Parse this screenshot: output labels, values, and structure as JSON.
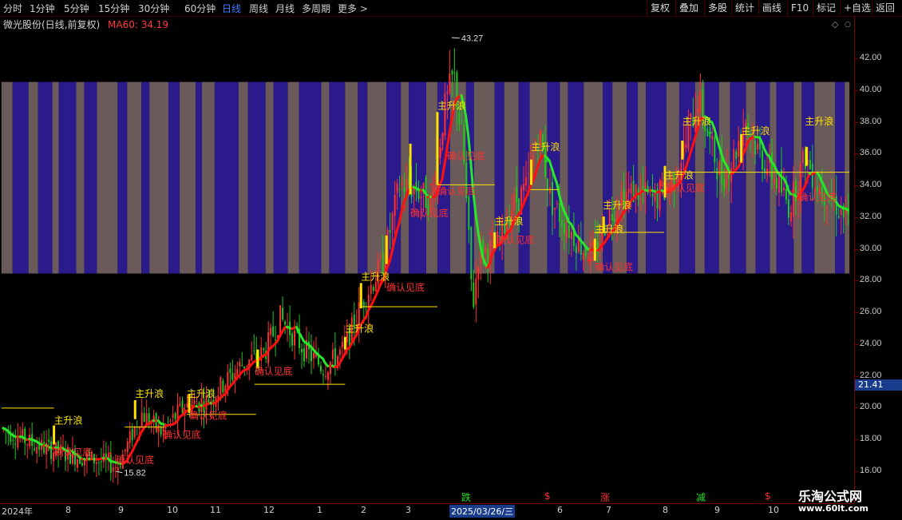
{
  "toolbar": {
    "periods": [
      "分时",
      "1分钟",
      "5分钟",
      "15分钟",
      "30分钟",
      "60分钟",
      "日线",
      "周线",
      "月线",
      "多周期",
      "更多 >"
    ],
    "active_period": "日线",
    "right_buttons": [
      "复权",
      "叠加",
      "多股",
      "统计",
      "画线",
      "F10",
      "标记",
      "+自选",
      "返回"
    ]
  },
  "info": {
    "stock_title": "微光股份(日线,前复权)",
    "ma_label": "MA60: 34.19"
  },
  "chart_data": {
    "type": "candlestick",
    "title": "微光股份(日线,前复权)",
    "y_axis_ticks": [
      "42.00",
      "40.00",
      "38.00",
      "36.00",
      "34.00",
      "32.00",
      "30.00",
      "28.00",
      "26.00",
      "24.00",
      "22.00",
      "20.00",
      "18.00",
      "16.00"
    ],
    "ylim": [
      15.2,
      43.5
    ],
    "current_price": "21.41",
    "high_marker": "43.27",
    "low_marker": "15.82",
    "x_axis_labels": [
      "2024年",
      "8",
      "9",
      "10",
      "11",
      "12",
      "1",
      "2",
      "3",
      "2025/03/26/三",
      "6",
      "7",
      "8",
      "9",
      "10"
    ],
    "selected_date": "2025/03/26/三",
    "ma60_value": 34.19,
    "signal_labels": {
      "main_wave": "主升浪",
      "bottom_confirm": "确认见底"
    },
    "event_markers": [
      "跌",
      "$",
      "涨",
      "$",
      "减",
      "$"
    ],
    "colors": {
      "up": "#ff3030",
      "down": "#1ec81e",
      "ma_up": "#ff1010",
      "ma_down": "#28e628",
      "signal_yellow": "#ffe400",
      "band_purple": "#2a1a8c",
      "band_gray": "#6a5a5a"
    }
  },
  "watermark": {
    "line1": "乐淘公式网",
    "line2": "www.60lt.com"
  }
}
